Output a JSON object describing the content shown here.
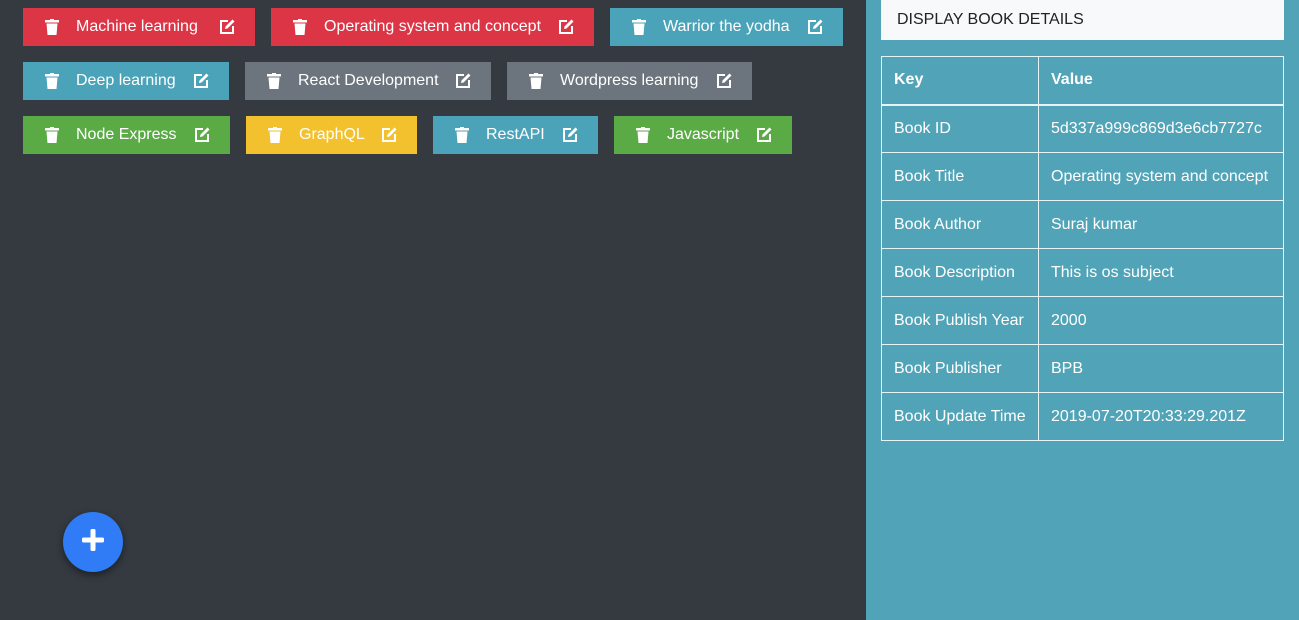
{
  "books": [
    {
      "title": "Machine learning",
      "color": "#dc3545"
    },
    {
      "title": "Operating system and concept",
      "color": "#dc3545"
    },
    {
      "title": "Warrior the yodha",
      "color": "#4aa3b8"
    },
    {
      "title": "Deep learning",
      "color": "#4aa3b8"
    },
    {
      "title": "React Development",
      "color": "#6c757d"
    },
    {
      "title": "Wordpress learning",
      "color": "#6c757d"
    },
    {
      "title": "Node Express",
      "color": "#5aab45"
    },
    {
      "title": "GraphQL",
      "color": "#f3c12d"
    },
    {
      "title": "RestAPI",
      "color": "#4aa3b8"
    },
    {
      "title": "Javascript",
      "color": "#5aab45"
    }
  ],
  "icons": {
    "delete": "trash-icon",
    "edit": "edit-icon",
    "add": "plus-icon"
  },
  "panel": {
    "title": "DISPLAY BOOK DETAILS",
    "columns": {
      "key": "Key",
      "value": "Value"
    },
    "rows": [
      {
        "key": "Book ID",
        "value": "5d337a999c869d3e6cb7727c"
      },
      {
        "key": "Book Title",
        "value": "Operating system and concept"
      },
      {
        "key": "Book Author",
        "value": "Suraj kumar"
      },
      {
        "key": "Book Description",
        "value": "This is os subject"
      },
      {
        "key": "Book Publish Year",
        "value": "2000"
      },
      {
        "key": "Book Publisher",
        "value": "BPB"
      },
      {
        "key": "Book Update Time",
        "value": "2019-07-20T20:33:29.201Z"
      }
    ]
  },
  "colors": {
    "background": "#343a40",
    "panel": "#51a4b8",
    "fab": "#2f7cf6"
  }
}
